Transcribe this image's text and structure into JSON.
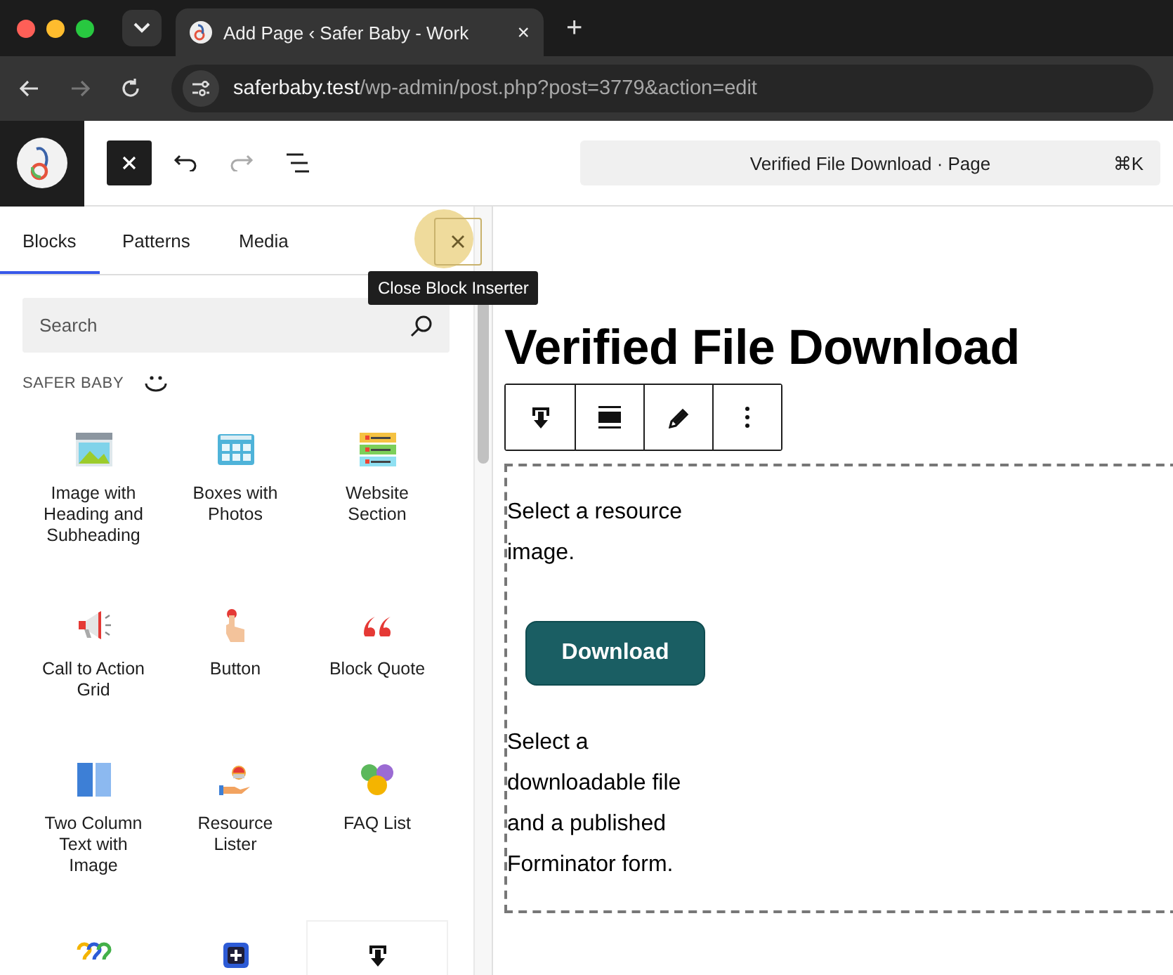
{
  "browser": {
    "tab": {
      "title": "Add Page ‹ Safer Baby - Work",
      "close": "×"
    },
    "new_tab": "+",
    "url": {
      "host": "saferbaby.test",
      "path": "/wp-admin/post.php?post=3779&action=edit"
    },
    "forward_disabled": true
  },
  "editor_header": {
    "redo_disabled": true,
    "command_bar": {
      "title": "Verified File Download · Page",
      "shortcut": "⌘K"
    }
  },
  "inserter": {
    "tabs": [
      {
        "label": "Blocks",
        "selected": true
      },
      {
        "label": "Patterns",
        "selected": false
      },
      {
        "label": "Media",
        "selected": false
      }
    ],
    "close_tooltip": "Close Block Inserter",
    "search": {
      "placeholder": "Search"
    },
    "category": "SAFER BABY",
    "blocks": [
      {
        "kind": "image-banner",
        "label": "Image with Heading and Subheading",
        "selected": false
      },
      {
        "kind": "photo-boxes",
        "label": "Boxes with Photos",
        "selected": false
      },
      {
        "kind": "numbered-list",
        "label": "Website Section",
        "selected": false
      },
      {
        "kind": "megaphone",
        "label": "Call to Action Grid",
        "selected": false
      },
      {
        "kind": "finger",
        "label": "Button",
        "selected": false
      },
      {
        "kind": "quote",
        "label": "Block Quote",
        "selected": false
      },
      {
        "kind": "columns",
        "label": "Two Column Text with Image",
        "selected": false
      },
      {
        "kind": "hand",
        "label": "Resource Lister",
        "selected": false
      },
      {
        "kind": "faq",
        "label": "FAQ List",
        "selected": false
      },
      {
        "kind": "questions",
        "selected": false
      },
      {
        "kind": "plus-box",
        "selected": false
      },
      {
        "kind": "download",
        "selected": true
      }
    ]
  },
  "canvas": {
    "title": "Verified File Download",
    "toolbar": [
      {
        "kind": "download"
      },
      {
        "kind": "align"
      },
      {
        "kind": "edit"
      },
      {
        "kind": "more"
      }
    ],
    "block": {
      "intro": "Select a resource image.",
      "button": "Download",
      "note": "Select a downloadable file and a published Forminator form."
    }
  }
}
